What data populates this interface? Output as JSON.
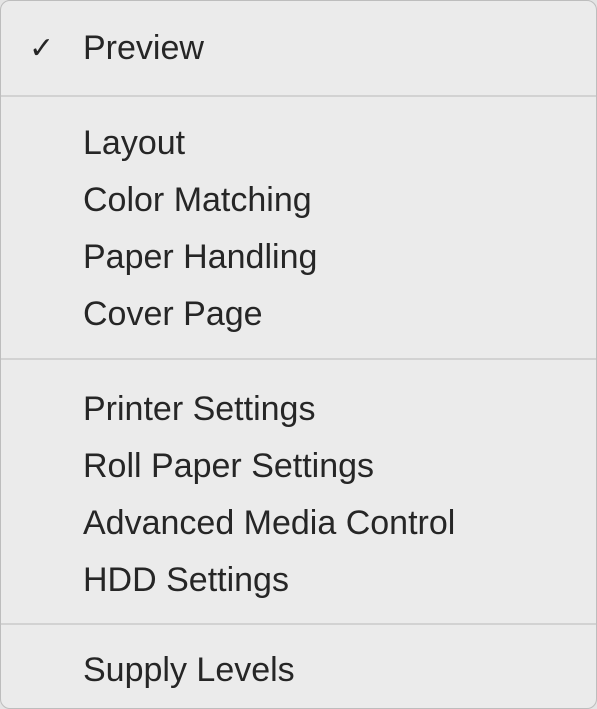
{
  "menu": {
    "sections": [
      [
        {
          "label": "Preview",
          "checked": true,
          "check_glyph": "✓"
        }
      ],
      [
        {
          "label": "Layout"
        },
        {
          "label": "Color Matching"
        },
        {
          "label": "Paper Handling"
        },
        {
          "label": "Cover Page"
        }
      ],
      [
        {
          "label": "Printer Settings"
        },
        {
          "label": "Roll Paper Settings"
        },
        {
          "label": "Advanced Media Control"
        },
        {
          "label": "HDD Settings"
        }
      ],
      [
        {
          "label": "Supply Levels"
        }
      ]
    ]
  },
  "colors": {
    "menu_background": "#ebebeb",
    "text": "#262626",
    "separator": "#d2d2d2"
  }
}
